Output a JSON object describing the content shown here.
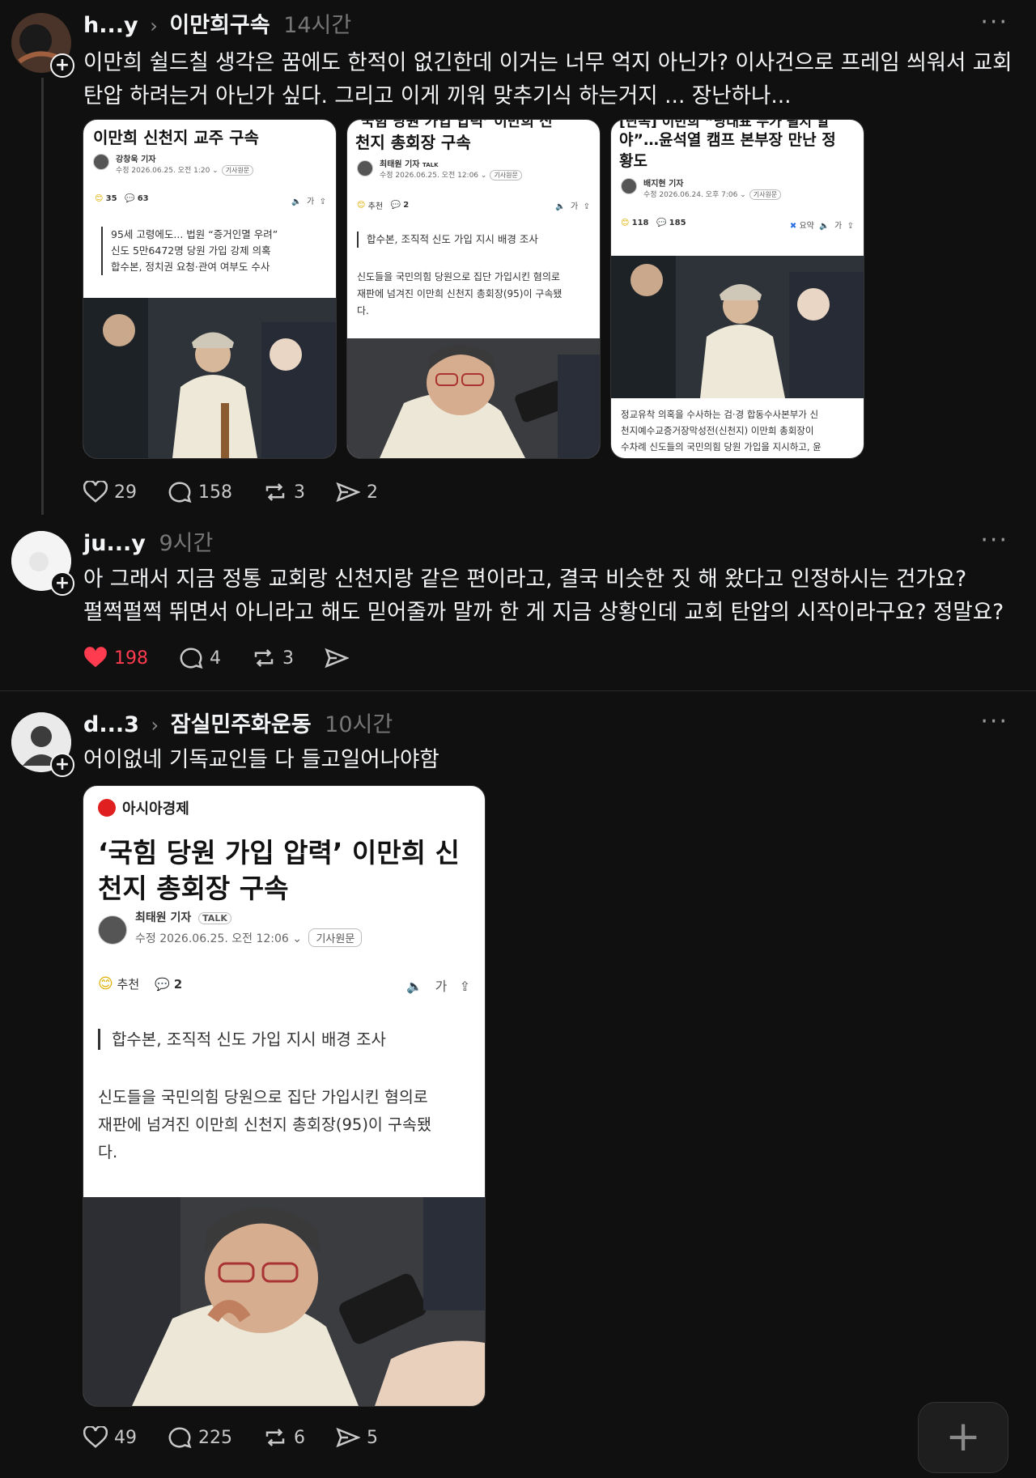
{
  "posts": [
    {
      "username": "h...y",
      "topic": "이만희구속",
      "time": "14시간",
      "text_line1": "이만희 쉴드칠 생각은 꿈에도 한적이 없긴한데 이거는 너무 억지 아닌가? 이사건으로 프레임 씌워서 교회",
      "text_line2": "탄압 하려는거 아닌가 싶다. 그리고 이게 끼워 맞추기식 하는거지 ... 장난하나...",
      "likes": "29",
      "replies": "158",
      "reposts": "3",
      "shares": "2"
    },
    {
      "username": "ju...y",
      "time": "9시간",
      "text_line1": "아 그래서 지금 정통 교회랑 신천지랑 같은 편이라고, 결국 비슷한 짓 해 왔다고 인정하시는 건가요?",
      "text_line2": "펄쩍펄쩍 뛰면서 아니라고 해도 믿어줄까 말까 한 게 지금 상황인데 교회 탄압의 시작이라구요? 정말요?",
      "likes": "198",
      "replies": "4",
      "reposts": "3"
    },
    {
      "username": "d...3",
      "topic": "잠실민주화운동",
      "time": "10시간",
      "text_line1": "어이없네  기독교인들  다 들고일어나야함",
      "likes": "49",
      "replies": "225",
      "reposts": "6",
      "shares": "5"
    }
  ],
  "cards": {
    "card1": {
      "title": "이만희 신천지 교주 구속",
      "reporter": "강창욱 기자",
      "date": "수정 2026.06.25. 오전 1:20",
      "pill": "기사원문",
      "reactions": "35",
      "comments": "63",
      "tools": "가",
      "quote1": "95세 고령에도... 법원 “증거인멸 우려”",
      "quote2": "신도 5만6472명 당원 가입 강제 의혹",
      "quote3": "합수본, 정치권 요청·관여 여부도 수사"
    },
    "card2": {
      "title_partial": "‘국힘 당원 가입 압력’ 이만희 신",
      "title": "천지 총회장 구속",
      "reporter": "최태원 기자",
      "talk": "TALK",
      "date": "수정 2026.06.25. 오전 12:06",
      "pill": "기사원문",
      "recommend": "추천",
      "comments": "2",
      "tools": "가",
      "quote": "합수본, 조직적 신도 가입 지시 배경 조사",
      "body1": "신도들을 국민의힘 당원으로 집단 가입시킨 혐의로",
      "body2": "재판에 넘겨진 이만희 신천지 총회장(95)이 구속됐",
      "body3": "다."
    },
    "card3": {
      "title_partial": "[단독] 이만희 “당대표 누가 될지 알",
      "title1": "야”…윤석열 캠프 본부장 만난 정",
      "title2": "황도",
      "reporter": "배지현 기자",
      "date": "수정 2026.06.24. 오후 7:06",
      "pill": "기사원문",
      "reactions": "118",
      "comments": "185",
      "summary": "요약",
      "tools": "가",
      "cap1": "정교유착 의혹을 수사하는 검·경 합동수사본부가 신",
      "cap2": "천지예수교증거장막성전(신천지) 이만희 총회장이",
      "cap3": "수차례 신도들의 국민의힘 당원 가입을 지시하고, 윤"
    },
    "card4": {
      "source": "아시아경제",
      "title1": "‘국힘 당원 가입 압력’ 이만희 신",
      "title2": "천지 총회장 구속",
      "reporter": "최태원 기자",
      "talk": "TALK",
      "date": "수정 2026.06.25. 오전 12:06",
      "pill": "기사원문",
      "recommend": "추천",
      "comments": "2",
      "tools": "가",
      "quote": "합수본, 조직적 신도 가입 지시 배경 조사",
      "body1": "신도들을 국민의힘 당원으로 집단 가입시킨 혐의로",
      "body2": "재판에 넘겨진 이만희 신천지 총회장(95)이 구속됐",
      "body3": "다."
    }
  },
  "fab": "+",
  "colors": {
    "background": "#101010",
    "like": "#ff3b4f",
    "muted": "#777777"
  }
}
